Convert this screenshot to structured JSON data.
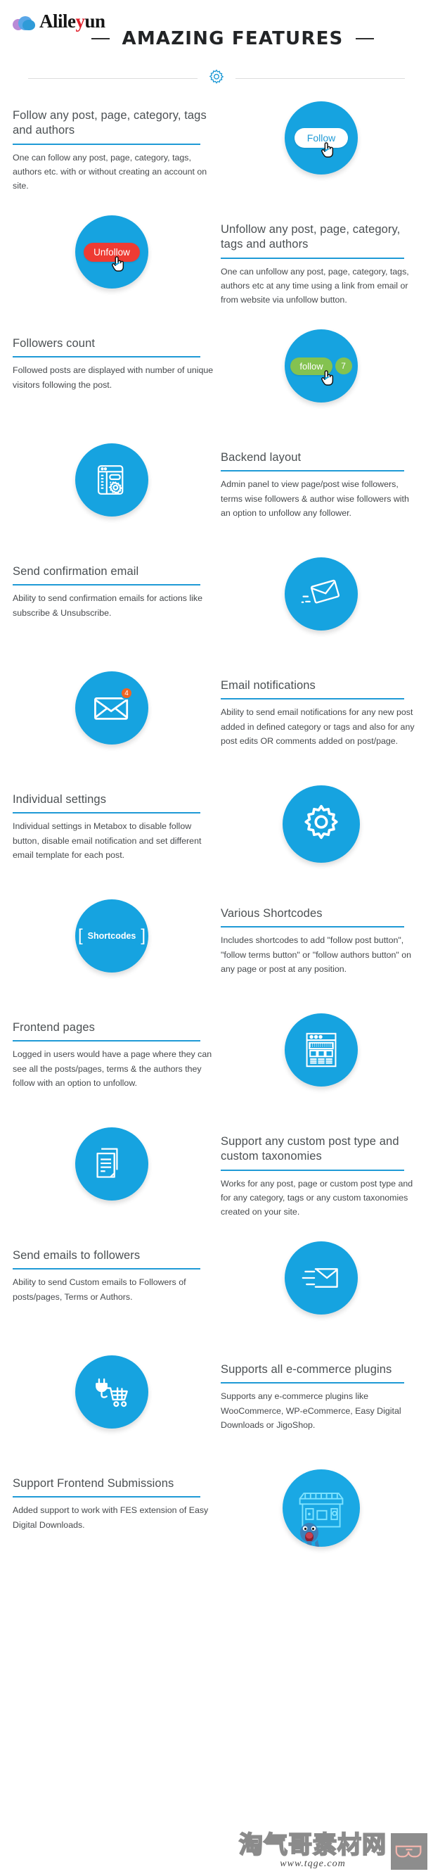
{
  "brand": {
    "name_part1": "Alile",
    "name_accent": "y",
    "name_part2": "un",
    "logo_icon": "cloud-logo-icon"
  },
  "header": {
    "title": "AMAZING FEATURES",
    "left_dash": "",
    "right_dash": "",
    "divider_icon": "gear-outline-icon"
  },
  "features": [
    {
      "side": "left",
      "title": "Follow any post, page, category, tags and authors",
      "desc": "One can follow any post, page, category, tags, authors etc. with or without creating an account on site.",
      "icon": "follow-button-icon",
      "button_label": "Follow",
      "button_style": "white"
    },
    {
      "side": "right",
      "title": "Unfollow any post, page, category, tags and authors",
      "desc": "One can unfollow any post, page, category, tags, authors etc at any time using a link from email or from website via unfollow button.",
      "icon": "unfollow-button-icon",
      "button_label": "Unfollow",
      "button_style": "red"
    },
    {
      "side": "left",
      "title": "Followers count",
      "desc": "Followed posts are displayed with number of unique visitors following the post.",
      "icon": "follow-count-icon",
      "button_label": "follow",
      "count": "7",
      "button_style": "green"
    },
    {
      "side": "right",
      "title": "Backend layout",
      "desc": "Admin panel to view page/post wise followers, terms wise followers & author wise followers with an option to unfollow any follower.",
      "icon": "admin-panel-icon"
    },
    {
      "side": "left",
      "title": "Send confirmation email",
      "desc": "Ability to send confirmation emails for actions like subscribe & Unsubscribe.",
      "icon": "flying-envelope-icon"
    },
    {
      "side": "right",
      "title": "Email notifications",
      "desc": "Ability to send email notifications for any new post added in defined category or tags and also for any post edits OR comments added on post/page.",
      "icon": "envelope-badge-icon",
      "badge": "4"
    },
    {
      "side": "left",
      "title": "Individual settings",
      "desc": "Individual settings in Metabox to disable follow button, disable email notification and set different email template for each post.",
      "icon": "gear-solid-icon"
    },
    {
      "side": "right",
      "title": "Various Shortcodes",
      "desc": "Includes shortcodes to add \"follow post button\", \"follow terms button\" or \"follow authors button\" on any page or post at any position.",
      "icon": "shortcodes-brackets-icon",
      "button_label": "Shortcodes"
    },
    {
      "side": "left",
      "title": "Frontend pages",
      "desc": "Logged in users would have a page where they can see all the posts/pages, terms & the authors they follow with an option to unfollow.",
      "icon": "webpage-layout-icon"
    },
    {
      "side": "right",
      "title": "Support any custom post type and custom taxonomies",
      "desc": "Works for any post, page or custom post type and for any category, tags or any custom taxonomies created on your site.",
      "icon": "documents-stack-icon"
    },
    {
      "side": "left",
      "title": "Send emails to followers",
      "desc": "Ability to send Custom emails to Followers of posts/pages, Terms or Authors.",
      "icon": "send-email-icon"
    },
    {
      "side": "right",
      "title": "Supports all e-commerce plugins",
      "desc": "Supports any e-commerce plugins like WooCommerce, WP-eCommerce, Easy Digital Downloads or JigoShop.",
      "icon": "plug-cart-icon"
    },
    {
      "side": "left",
      "title": "Support Frontend Submissions",
      "desc": "Added support to work with FES extension of Easy Digital Downloads.",
      "icon": "storefront-icon"
    }
  ],
  "watermark": {
    "chinese": "淘气哥素材网",
    "url": "www.tqge.com",
    "logo_icon": "glasses-logo-icon"
  },
  "colors": {
    "accent_blue": "#16a3e0",
    "rule_blue": "#1f9ad6",
    "red": "#ee3b33",
    "green": "#84c250",
    "orange": "#f26522",
    "text": "#46494c"
  }
}
